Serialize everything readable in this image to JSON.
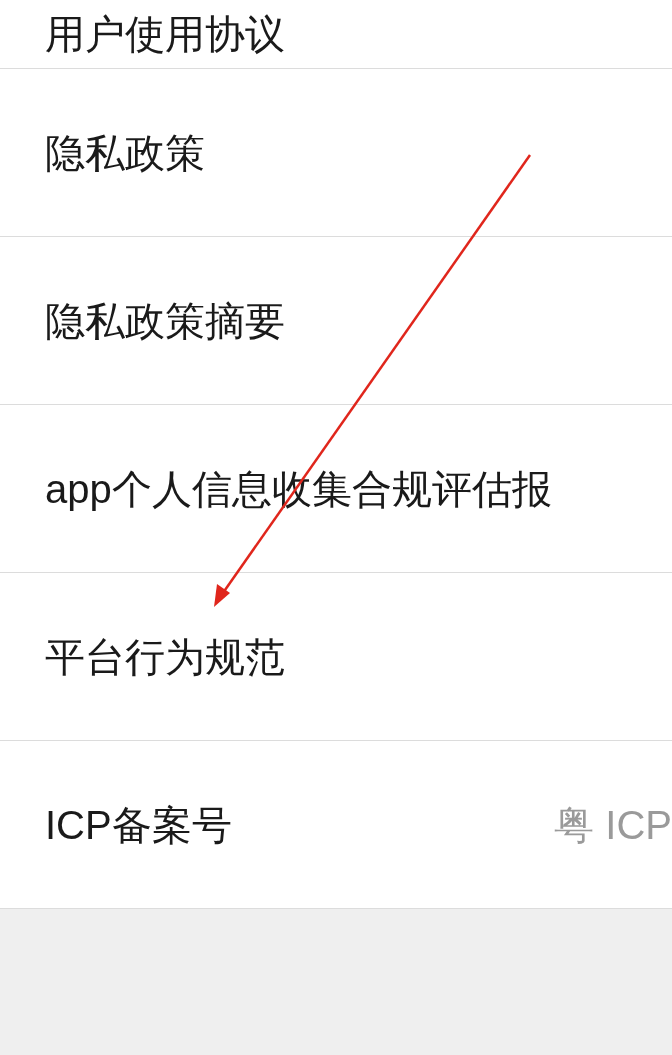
{
  "settings_list": [
    {
      "label": "用户使用协议"
    },
    {
      "label": "隐私政策"
    },
    {
      "label": "隐私政策摘要"
    },
    {
      "label": "app个人信息收集合规评估报"
    },
    {
      "label": "平台行为规范"
    },
    {
      "label": "ICP备案号",
      "value": "粤 ICP"
    }
  ],
  "annotation": {
    "kind": "arrow",
    "color": "#e0261c"
  }
}
